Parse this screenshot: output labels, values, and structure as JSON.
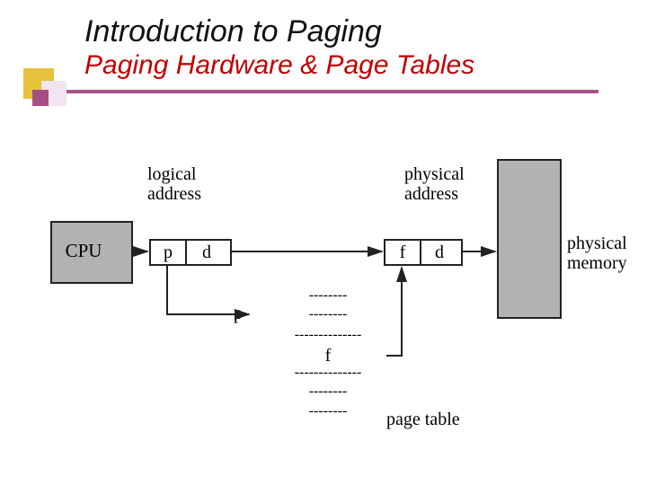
{
  "title": {
    "main": "Introduction to Paging",
    "sub": "Paging Hardware & Page Tables"
  },
  "labels": {
    "cpu": "CPU",
    "logical_address": "logical\naddress",
    "physical_address": "physical\naddress",
    "physical_memory": "physical\nmemory",
    "page_table": "page table"
  },
  "addr": {
    "logical_p": "p",
    "logical_d": "d",
    "physical_f": "f",
    "physical_d": "d"
  },
  "page_table": {
    "index_p": "p",
    "rows": [
      "--------",
      "--------",
      "--------------",
      "f",
      "--------------",
      "--------",
      "--------"
    ]
  }
}
